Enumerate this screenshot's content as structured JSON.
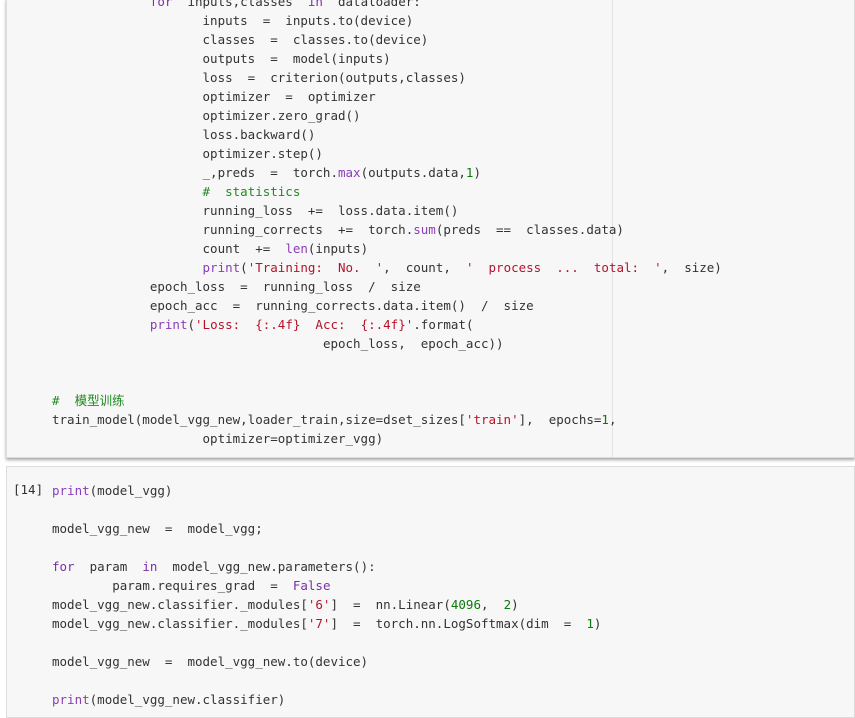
{
  "cells": [
    {
      "id": "training-cell",
      "prompt": "",
      "lines": [
        {
          "indent": "             ",
          "tokens": [
            {
              "t": "kw",
              "v": "for"
            },
            {
              "t": "",
              "v": "  inputs,classes  "
            },
            {
              "t": "kw",
              "v": "in"
            },
            {
              "t": "",
              "v": "  dataloader:"
            }
          ]
        },
        {
          "indent": "                    ",
          "tokens": [
            {
              "t": "",
              "v": "inputs  =  inputs.to(device)"
            }
          ]
        },
        {
          "indent": "                    ",
          "tokens": [
            {
              "t": "",
              "v": "classes  =  classes.to(device)"
            }
          ]
        },
        {
          "indent": "                    ",
          "tokens": [
            {
              "t": "",
              "v": "outputs  =  model(inputs)"
            }
          ]
        },
        {
          "indent": "                    ",
          "tokens": [
            {
              "t": "",
              "v": "loss  =  criterion(outputs,classes)"
            }
          ]
        },
        {
          "indent": "                    ",
          "tokens": [
            {
              "t": "",
              "v": "optimizer  =  optimizer"
            }
          ]
        },
        {
          "indent": "                    ",
          "tokens": [
            {
              "t": "",
              "v": "optimizer.zero_grad()"
            }
          ]
        },
        {
          "indent": "                    ",
          "tokens": [
            {
              "t": "",
              "v": "loss.backward()"
            }
          ]
        },
        {
          "indent": "                    ",
          "tokens": [
            {
              "t": "",
              "v": "optimizer.step()"
            }
          ]
        },
        {
          "indent": "                    ",
          "tokens": [
            {
              "t": "",
              "v": "_,preds  =  torch."
            },
            {
              "t": "fn",
              "v": "max"
            },
            {
              "t": "",
              "v": "(outputs.data,"
            },
            {
              "t": "num",
              "v": "1"
            },
            {
              "t": "",
              "v": ")"
            }
          ]
        },
        {
          "indent": "                    ",
          "tokens": [
            {
              "t": "cmt",
              "v": "#  statistics"
            }
          ]
        },
        {
          "indent": "                    ",
          "tokens": [
            {
              "t": "",
              "v": "running_loss  +=  loss.data.item()"
            }
          ]
        },
        {
          "indent": "                    ",
          "tokens": [
            {
              "t": "",
              "v": "running_corrects  +=  torch."
            },
            {
              "t": "fn",
              "v": "sum"
            },
            {
              "t": "",
              "v": "(preds  ==  classes.data)"
            }
          ]
        },
        {
          "indent": "                    ",
          "tokens": [
            {
              "t": "",
              "v": "count  +=  "
            },
            {
              "t": "fn",
              "v": "len"
            },
            {
              "t": "",
              "v": "(inputs)"
            }
          ]
        },
        {
          "indent": "                    ",
          "tokens": [
            {
              "t": "fn",
              "v": "print"
            },
            {
              "t": "",
              "v": "("
            },
            {
              "t": "str",
              "v": "'Training:  No.  '"
            },
            {
              "t": "",
              "v": ",  count,  "
            },
            {
              "t": "str",
              "v": "'  process  ...  total:  '"
            },
            {
              "t": "",
              "v": ",  size)"
            }
          ]
        },
        {
          "indent": "             ",
          "tokens": [
            {
              "t": "",
              "v": "epoch_loss  =  running_loss  /  size"
            }
          ]
        },
        {
          "indent": "             ",
          "tokens": [
            {
              "t": "",
              "v": "epoch_acc  =  running_corrects.data.item()  /  size"
            }
          ]
        },
        {
          "indent": "             ",
          "tokens": [
            {
              "t": "fn",
              "v": "print"
            },
            {
              "t": "",
              "v": "("
            },
            {
              "t": "str",
              "v": "'Loss:  {:.4f}  Acc:  {:.4f}'"
            },
            {
              "t": "",
              "v": ".format("
            }
          ]
        },
        {
          "indent": "                                    ",
          "tokens": [
            {
              "t": "",
              "v": "epoch_loss,  epoch_acc))"
            }
          ]
        },
        {
          "indent": "",
          "tokens": []
        },
        {
          "indent": "",
          "tokens": []
        },
        {
          "indent": "",
          "tokens": [
            {
              "t": "cmt",
              "v": "#  模型训练"
            }
          ]
        },
        {
          "indent": "",
          "tokens": [
            {
              "t": "",
              "v": "train_model(model_vgg_new,loader_train,size=dset_sizes["
            },
            {
              "t": "str",
              "v": "'train'"
            },
            {
              "t": "",
              "v": "],  epochs="
            },
            {
              "t": "num",
              "v": "1"
            },
            {
              "t": "",
              "v": ","
            }
          ]
        },
        {
          "indent": "                    ",
          "tokens": [
            {
              "t": "",
              "v": "optimizer=optimizer_vgg)"
            }
          ]
        }
      ]
    },
    {
      "id": "model-cell",
      "prompt": "[14]",
      "lines": [
        {
          "indent": "",
          "tokens": [
            {
              "t": "fn",
              "v": "print"
            },
            {
              "t": "",
              "v": "(model_vgg)"
            }
          ]
        },
        {
          "indent": "",
          "tokens": []
        },
        {
          "indent": "",
          "tokens": [
            {
              "t": "",
              "v": "model_vgg_new  =  model_vgg;"
            }
          ]
        },
        {
          "indent": "",
          "tokens": []
        },
        {
          "indent": "",
          "tokens": [
            {
              "t": "kw",
              "v": "for"
            },
            {
              "t": "",
              "v": "  param  "
            },
            {
              "t": "kw",
              "v": "in"
            },
            {
              "t": "",
              "v": "  model_vgg_new.parameters():"
            }
          ]
        },
        {
          "indent": "        ",
          "tokens": [
            {
              "t": "",
              "v": "param.requires_grad  =  "
            },
            {
              "t": "kw",
              "v": "False"
            }
          ]
        },
        {
          "indent": "",
          "tokens": [
            {
              "t": "",
              "v": "model_vgg_new.classifier._modules["
            },
            {
              "t": "str",
              "v": "'6'"
            },
            {
              "t": "",
              "v": "]  =  nn.Linear("
            },
            {
              "t": "num",
              "v": "4096"
            },
            {
              "t": "",
              "v": ",  "
            },
            {
              "t": "num",
              "v": "2"
            },
            {
              "t": "",
              "v": ")"
            }
          ]
        },
        {
          "indent": "",
          "tokens": [
            {
              "t": "",
              "v": "model_vgg_new.classifier._modules["
            },
            {
              "t": "str",
              "v": "'7'"
            },
            {
              "t": "",
              "v": "]  =  torch.nn.LogSoftmax(dim  =  "
            },
            {
              "t": "num",
              "v": "1"
            },
            {
              "t": "",
              "v": ")"
            }
          ]
        },
        {
          "indent": "",
          "tokens": []
        },
        {
          "indent": "",
          "tokens": [
            {
              "t": "",
              "v": "model_vgg_new  =  model_vgg_new.to(device)"
            }
          ]
        },
        {
          "indent": "",
          "tokens": []
        },
        {
          "indent": "",
          "tokens": [
            {
              "t": "fn",
              "v": "print"
            },
            {
              "t": "",
              "v": "(model_vgg_new.classifier)"
            }
          ]
        }
      ]
    }
  ],
  "colors": {
    "keyword": "#7a2fa8",
    "string": "#b5132b",
    "number": "#0b7a0b",
    "comment": "#218a21",
    "builtin": "#8a3db8",
    "cell_background": "#f7f7f7"
  }
}
